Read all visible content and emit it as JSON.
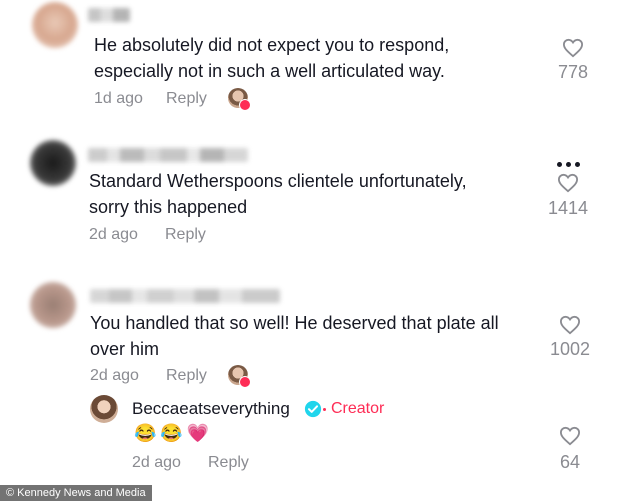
{
  "comments": [
    {
      "text_line1": "He absolutely did not expect you to respond,",
      "text_line2": "especially not in such a well articulated way.",
      "age": "1d ago",
      "reply_label": "Reply",
      "likes": "778"
    },
    {
      "text_line1": "Standard Wetherspoons clientele unfortunately,",
      "text_line2": "sorry this happened",
      "age": "2d ago",
      "reply_label": "Reply",
      "likes": "1414"
    },
    {
      "text_line1": "You handled that so well! He deserved that plate all",
      "text_line2": "over him",
      "age": "2d ago",
      "reply_label": "Reply",
      "likes": "1002"
    }
  ],
  "creator_reply": {
    "username": "Beccaeatseverything",
    "tag": "Creator",
    "emojis": [
      "😂",
      "😂",
      "💗"
    ],
    "age": "2d ago",
    "reply_label": "Reply",
    "likes": "64"
  },
  "footer": {
    "credit": "© Kennedy News and Media"
  },
  "colors": {
    "accent": "#fe2c55",
    "verified": "#20d5ec",
    "muted": "#8a8b91"
  },
  "icons": {
    "like": "heart-outline-icon",
    "more": "more-dots-icon",
    "verified": "verified-check-icon"
  }
}
